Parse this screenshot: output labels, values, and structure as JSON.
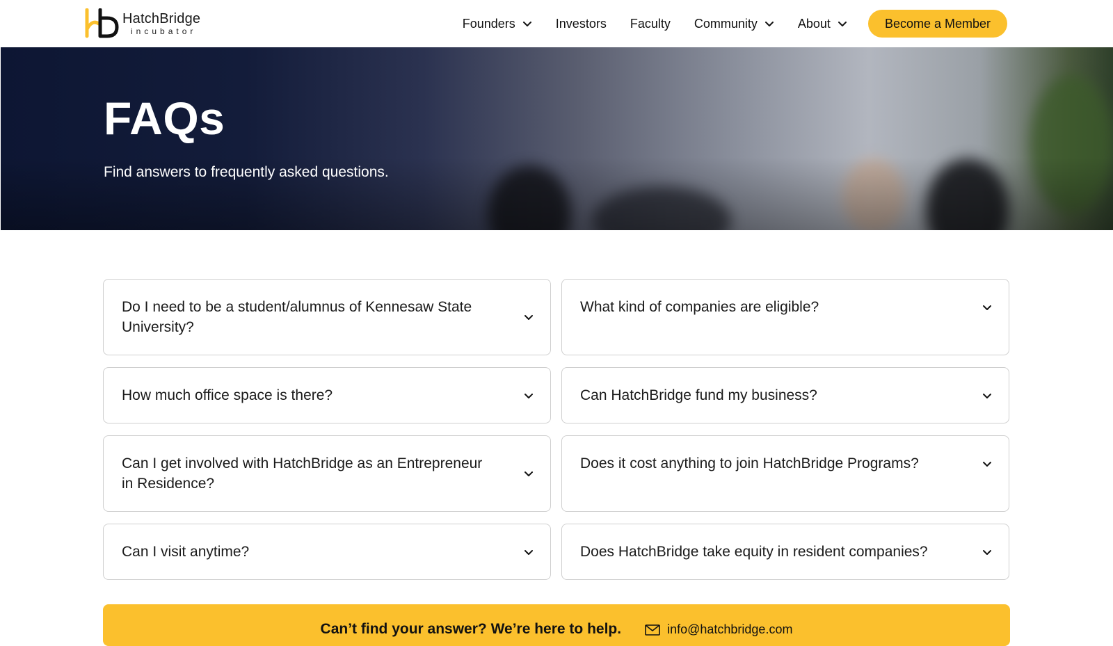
{
  "header": {
    "logo": {
      "name": "HatchBridge",
      "sub": "incubator"
    },
    "nav": [
      {
        "label": "Founders",
        "dropdown": true
      },
      {
        "label": "Investors",
        "dropdown": false
      },
      {
        "label": "Faculty",
        "dropdown": false
      },
      {
        "label": "Community",
        "dropdown": true
      },
      {
        "label": "About",
        "dropdown": true
      }
    ],
    "cta_label": "Become a Member"
  },
  "hero": {
    "title": "FAQs",
    "subtitle": "Find answers to frequently asked questions."
  },
  "faqs": [
    "Do I need to be a student/alumnus of Kennesaw State University?",
    "What kind of companies are eligible?",
    "How much office space is there?",
    "Can HatchBridge fund my business?",
    "Can I get involved with HatchBridge as an Entrepreneur in Residence?",
    "Does it cost anything to join HatchBridge Programs?",
    "Can I visit anytime?",
    "Does HatchBridge take equity in resident companies?"
  ],
  "help": {
    "text": "Can’t find your answer? We’re here to help.",
    "email": "info@hatchbridge.com"
  },
  "colors": {
    "accent": "#fbc02d",
    "hero_dark": "#0d1633",
    "card_border": "#cfcfcf"
  }
}
